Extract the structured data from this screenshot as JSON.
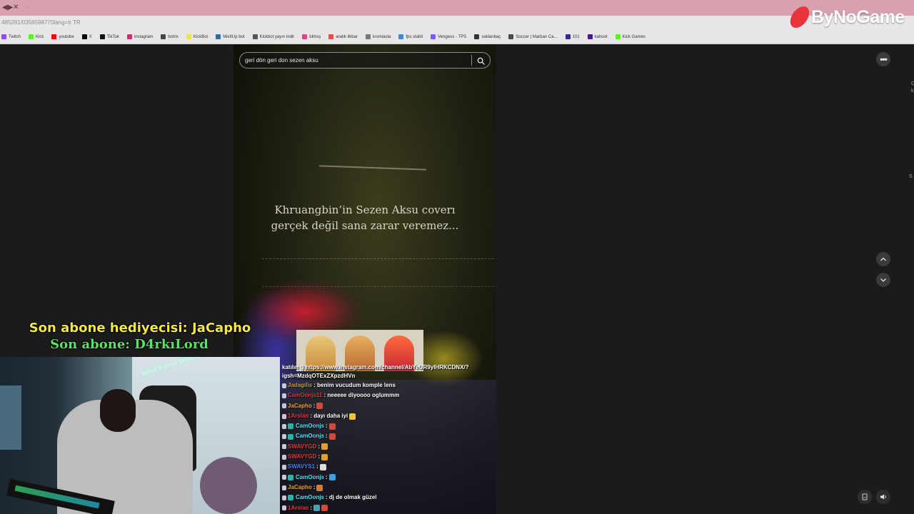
{
  "browser": {
    "tab_controls": [
      "◀▶",
      "✕",
      "+"
    ],
    "url_text": "485281/0356598770lang=tr TR"
  },
  "bookmarks": [
    {
      "label": "Twitch",
      "color": "#9146ff"
    },
    {
      "label": "Kick",
      "color": "#53fc18"
    },
    {
      "label": "youtube",
      "color": "#ff0000"
    },
    {
      "label": "X",
      "color": "#000000"
    },
    {
      "label": "TikTok",
      "color": "#111111"
    },
    {
      "label": "instagram",
      "color": "#d62976"
    },
    {
      "label": "botrix",
      "color": "#444444"
    },
    {
      "label": "KickBot",
      "color": "#e6e64a"
    },
    {
      "label": "MixItUp bot",
      "color": "#2b6cb0"
    },
    {
      "label": "Kickbot yayın indir",
      "color": "#555555"
    },
    {
      "label": "bitmış",
      "color": "#e0428a"
    },
    {
      "label": "aralık ilkbar",
      "color": "#e05050"
    },
    {
      "label": "kısmiaola",
      "color": "#777777"
    },
    {
      "label": "fps stabil",
      "color": "#3a8dd0"
    },
    {
      "label": "Vengeus - TPS",
      "color": "#7a5af8"
    },
    {
      "label": "saklanbaç",
      "color": "#333333"
    },
    {
      "label": "Soccer | Marban Ca...",
      "color": "#4a4a4a"
    },
    {
      "label": "101",
      "color": "#2e2e8a"
    },
    {
      "label": "kahoot",
      "color": "#46178f"
    },
    {
      "label": "Kick Games",
      "color": "#53fc18"
    }
  ],
  "brand": {
    "name": "ByNoGame",
    "color": "#e8343a"
  },
  "search": {
    "value": "geri dön geri don sezen aksu"
  },
  "video": {
    "caption_line1": "Khruangbin’in Sezen Aksu coverı",
    "caption_line2": "gerçek değil sana zarar veremez..."
  },
  "controls": {
    "more": "•••"
  },
  "overlay": {
    "gift_text": "Son abone hediyecisi: JaCapho",
    "sub_text": "Son abone: D4rkıLord"
  },
  "webcam": {
    "neon_text": "what's your problem?"
  },
  "chat": {
    "first_line": "katılın :) https://www.instagram.com/channel/AbYeUR9yIHRKCDNX/?igsh=MzdqOTExZXpzdHVn",
    "messages": [
      {
        "user": "Jadagilis",
        "user_color": "#c99b2e",
        "text": " : benim vucudum komple lens",
        "emotes": []
      },
      {
        "user": "CamOonjs11",
        "user_color": "#e0383c",
        "text": " : neeeee diyoooo oglummm",
        "emotes": []
      },
      {
        "user": "JaCapho",
        "user_color": "#f0a020",
        "text": " :",
        "emotes": [
          "#d24b3a"
        ]
      },
      {
        "user": "1Arslan",
        "user_color": "#e0383c",
        "text": " : dayı daha iyi",
        "emotes": [
          "#f2c23a"
        ]
      },
      {
        "user": "CamOonjs",
        "user_color": "#4de2ff",
        "text": " :",
        "emotes": [
          "#d24b3a"
        ]
      },
      {
        "user": "CamOonjs",
        "user_color": "#4de2ff",
        "text": " :",
        "emotes": [
          "#d24b3a"
        ]
      },
      {
        "user": "SWAVYGD",
        "user_color": "#e0383c",
        "text": " :",
        "emotes": [
          "#e0a030"
        ]
      },
      {
        "user": "SWAVYGD",
        "user_color": "#e0383c",
        "text": " :",
        "emotes": [
          "#e0a030"
        ]
      },
      {
        "user": "SWAVYS1",
        "user_color": "#4a7dff",
        "text": " :",
        "emotes": [
          "#dddddd"
        ]
      },
      {
        "user": "CamOonjs",
        "user_color": "#4de2ff",
        "text": " :",
        "emotes": [
          "#3aa0e0"
        ]
      },
      {
        "user": "JaCapho",
        "user_color": "#f0a020",
        "text": " :",
        "emotes": [
          "#d27a3a"
        ]
      },
      {
        "user": "CamOonjs",
        "user_color": "#4de2ff",
        "text": " : dj de olmak güzel",
        "emotes": []
      },
      {
        "user": "1Arslan",
        "user_color": "#e0383c",
        "text": " :",
        "emotes": [
          "#4aa0b0",
          "#d24b3a"
        ]
      }
    ]
  },
  "right_edge": {
    "letter_c": "C",
    "letter_k": "k",
    "letter_s": "S"
  }
}
